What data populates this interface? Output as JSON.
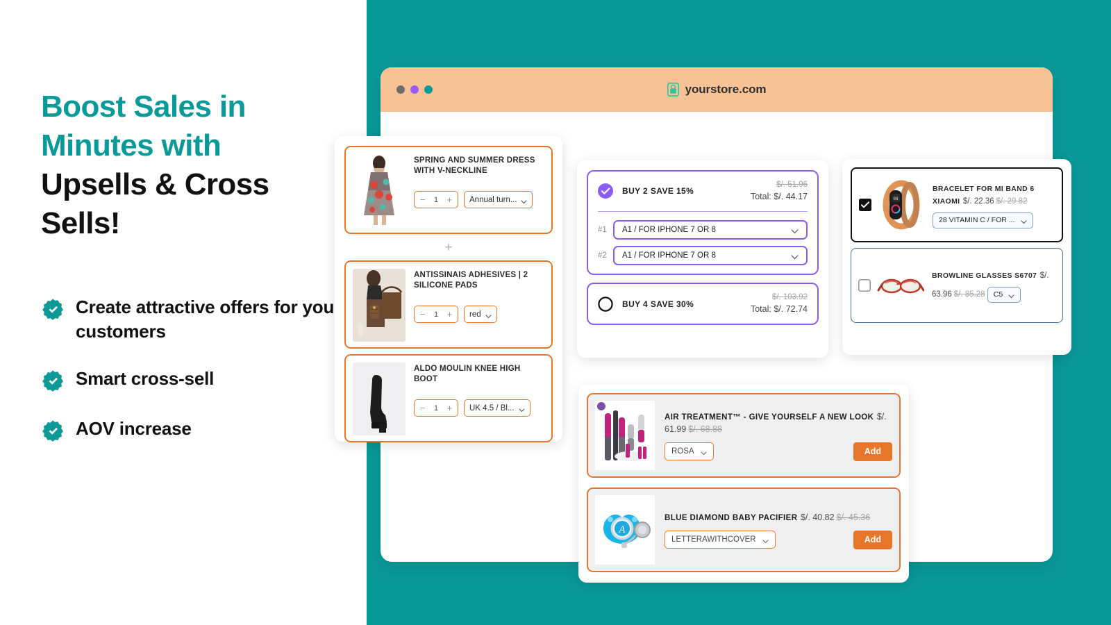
{
  "colors": {
    "teal": "#089a99",
    "peach": "#f6c296",
    "orange": "#e8762a",
    "purple": "#8b5cf6",
    "blue": "#3f6fa8",
    "dark": "#111111"
  },
  "marketing": {
    "headline_line1": "Boost Sales in",
    "headline_line2": "Minutes with",
    "headline_line3": "Upsells & Cross",
    "headline_line4": "Sells!",
    "bullets": [
      {
        "text": "Create attractive offers for your customers"
      },
      {
        "text": "Smart cross-sell"
      },
      {
        "text": "AOV increase"
      }
    ]
  },
  "browser": {
    "url": "yourstore.com",
    "lock_icon": "lock-icon",
    "dots": [
      "gray",
      "purple",
      "teal"
    ]
  },
  "bundle_panel": {
    "plus_separator": "+",
    "products": [
      {
        "title": "SPRING AND SUMMER DRESS WITH V-NECKLINE",
        "qty": "1",
        "minus": "−",
        "plus": "+",
        "variant": "Annual turn..."
      },
      {
        "title": "ANTISSINAIS ADHESIVES | 2 SILICONE PADS",
        "qty": "1",
        "minus": "−",
        "plus": "+",
        "variant": "red"
      },
      {
        "title": "ALDO MOULIN KNEE HIGH BOOT",
        "qty": "1",
        "minus": "−",
        "plus": "+",
        "variant": "UK 4.5 / Bl..."
      }
    ]
  },
  "volume_panel": {
    "tiers": [
      {
        "label": "BUY 2 SAVE 15%",
        "selected": true,
        "price_old": "$/. 51.96",
        "price_total": "Total: $/. 44.17",
        "variants": [
          {
            "num": "#1",
            "value": "A1 / FOR IPHONE 7 OR 8"
          },
          {
            "num": "#2",
            "value": "A1 / FOR IPHONE 7 OR 8"
          }
        ]
      },
      {
        "label": "BUY 4 SAVE 30%",
        "selected": false,
        "price_old": "$/. 103.92",
        "price_total": "Total: $/. 72.74",
        "variants": []
      }
    ]
  },
  "crosssell_right": {
    "items": [
      {
        "title": "BRACELET FOR MI BAND 6 XIAOMI",
        "checked": true,
        "price": "$/. 22.36",
        "price_old": "$/. 29.82",
        "variant": "28 VITAMIN C / FOR ..."
      },
      {
        "title": "BROWLINE GLASSES S6707",
        "checked": false,
        "price": "$/. 63.96",
        "price_old": "$/. 85.28",
        "variant": "C5"
      }
    ]
  },
  "addon_panel": {
    "items": [
      {
        "title": "AIR TREATMENT™ - GIVE YOURSELF A NEW LOOK",
        "price": "$/. 61.99",
        "price_old": "$/. 68.88",
        "variant": "ROSA",
        "add_label": "Add"
      },
      {
        "title": "BLUE DIAMOND BABY PACIFIER",
        "price": "$/. 40.82",
        "price_old": "$/. 45.36",
        "variant": "LETTERAWITHCOVER",
        "add_label": "Add"
      }
    ]
  }
}
